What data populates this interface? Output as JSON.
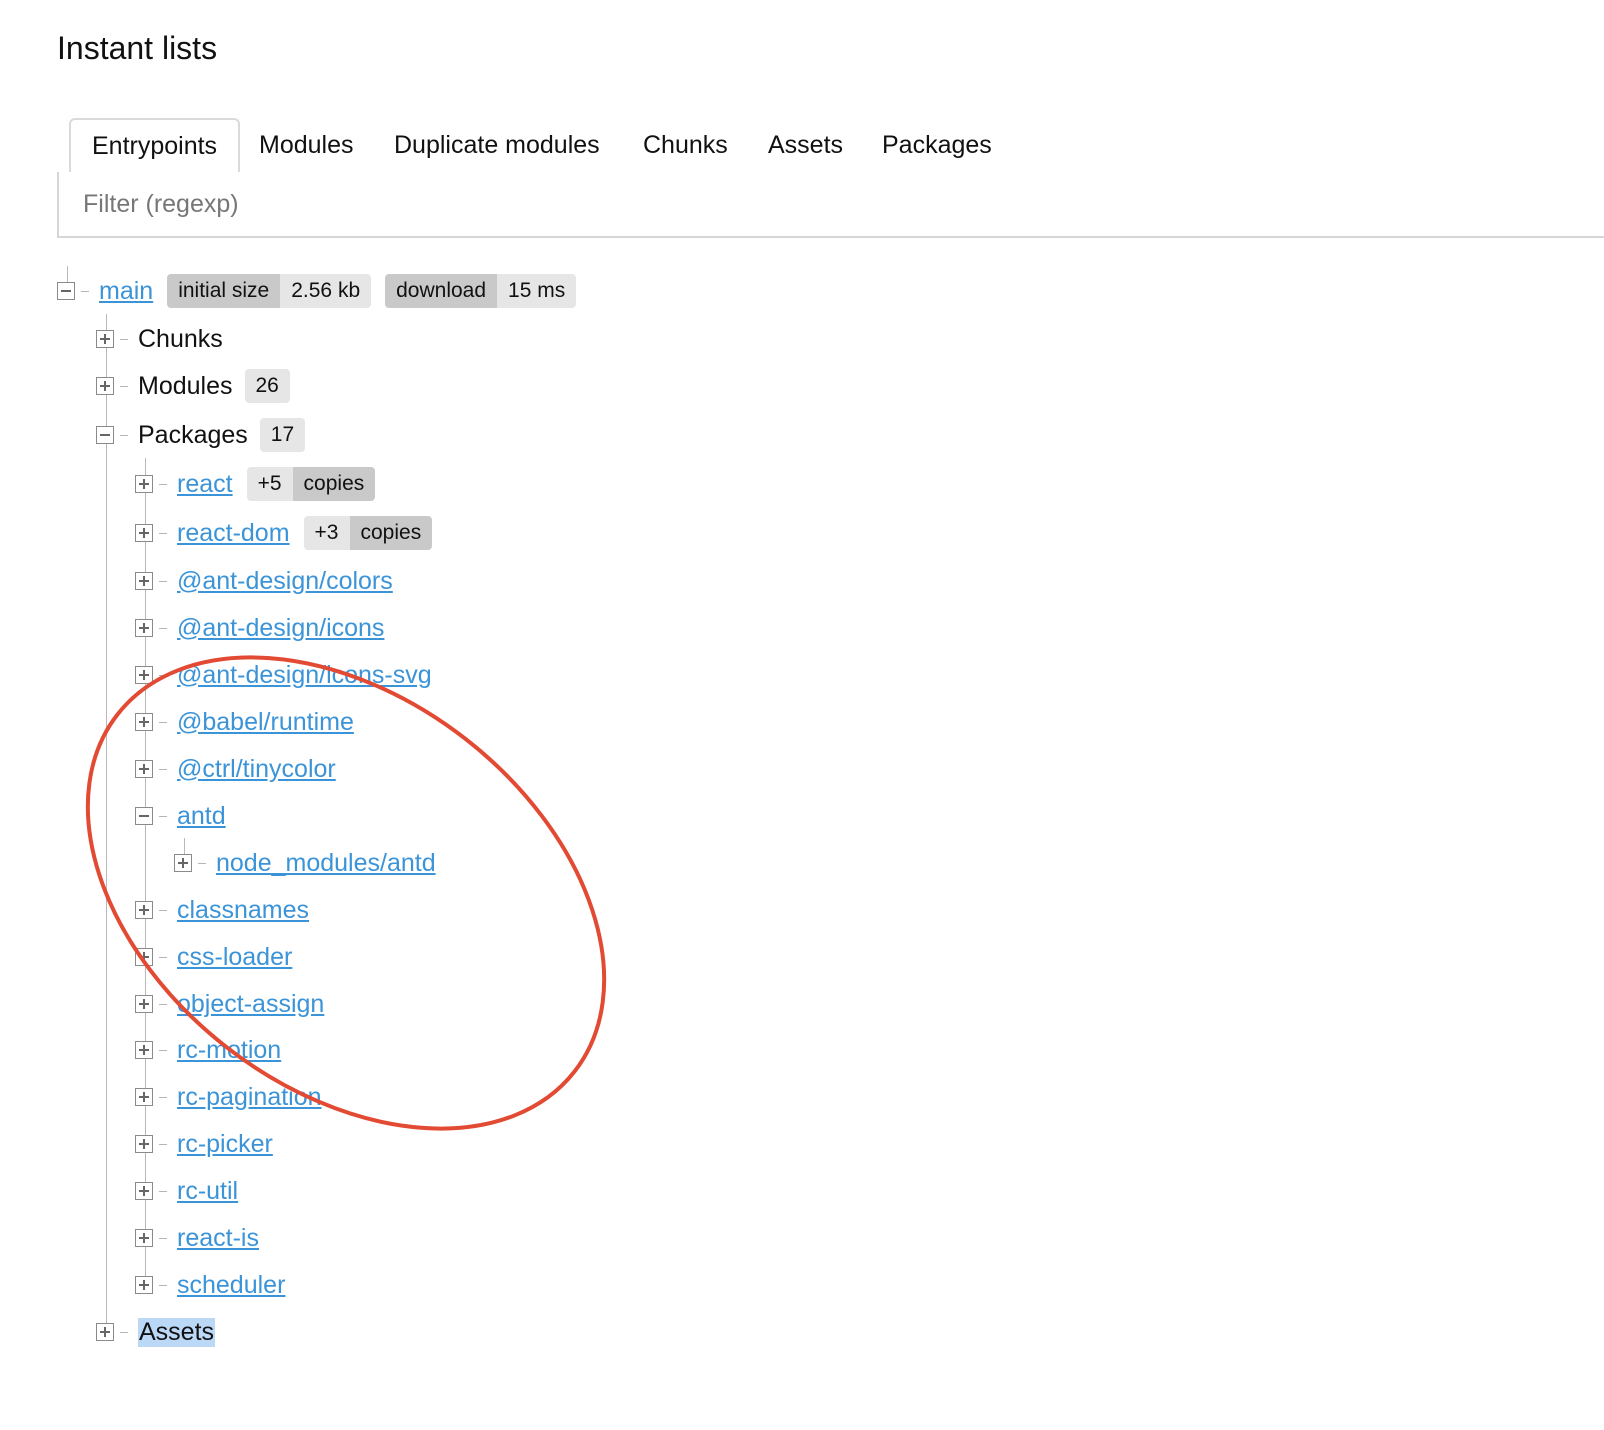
{
  "page": {
    "title": "Instant lists"
  },
  "tabs": [
    {
      "label": "Entrypoints",
      "active": true
    },
    {
      "label": "Modules"
    },
    {
      "label": "Duplicate modules"
    },
    {
      "label": "Chunks"
    },
    {
      "label": "Assets"
    },
    {
      "label": "Packages"
    }
  ],
  "filter": {
    "placeholder": "Filter (regexp)",
    "value": ""
  },
  "tree": {
    "entry": {
      "name": "main",
      "initial_size_label": "initial size",
      "initial_size_value": "2.56 kb",
      "download_label": "download",
      "download_value": "15 ms"
    },
    "chunks_label": "Chunks",
    "modules_label": "Modules",
    "modules_count": "26",
    "packages_label": "Packages",
    "packages_count": "17",
    "copies_label": "copies",
    "packages": [
      {
        "name": "react",
        "copies": "+5"
      },
      {
        "name": "react-dom",
        "copies": "+3"
      },
      {
        "name": "@ant-design/colors"
      },
      {
        "name": "@ant-design/icons"
      },
      {
        "name": "@ant-design/icons-svg"
      },
      {
        "name": "@babel/runtime"
      },
      {
        "name": "@ctrl/tinycolor"
      },
      {
        "name": "antd",
        "expanded": true,
        "child": "node_modules/antd"
      },
      {
        "name": "classnames"
      },
      {
        "name": "css-loader"
      },
      {
        "name": "object-assign"
      },
      {
        "name": "rc-motion"
      },
      {
        "name": "rc-pagination"
      },
      {
        "name": "rc-picker"
      },
      {
        "name": "rc-util"
      },
      {
        "name": "react-is"
      },
      {
        "name": "scheduler"
      }
    ],
    "assets_label": "Assets"
  },
  "colors": {
    "link": "#3b93d8",
    "annotation": "#e24a33",
    "selection": "#bcd8f7"
  }
}
